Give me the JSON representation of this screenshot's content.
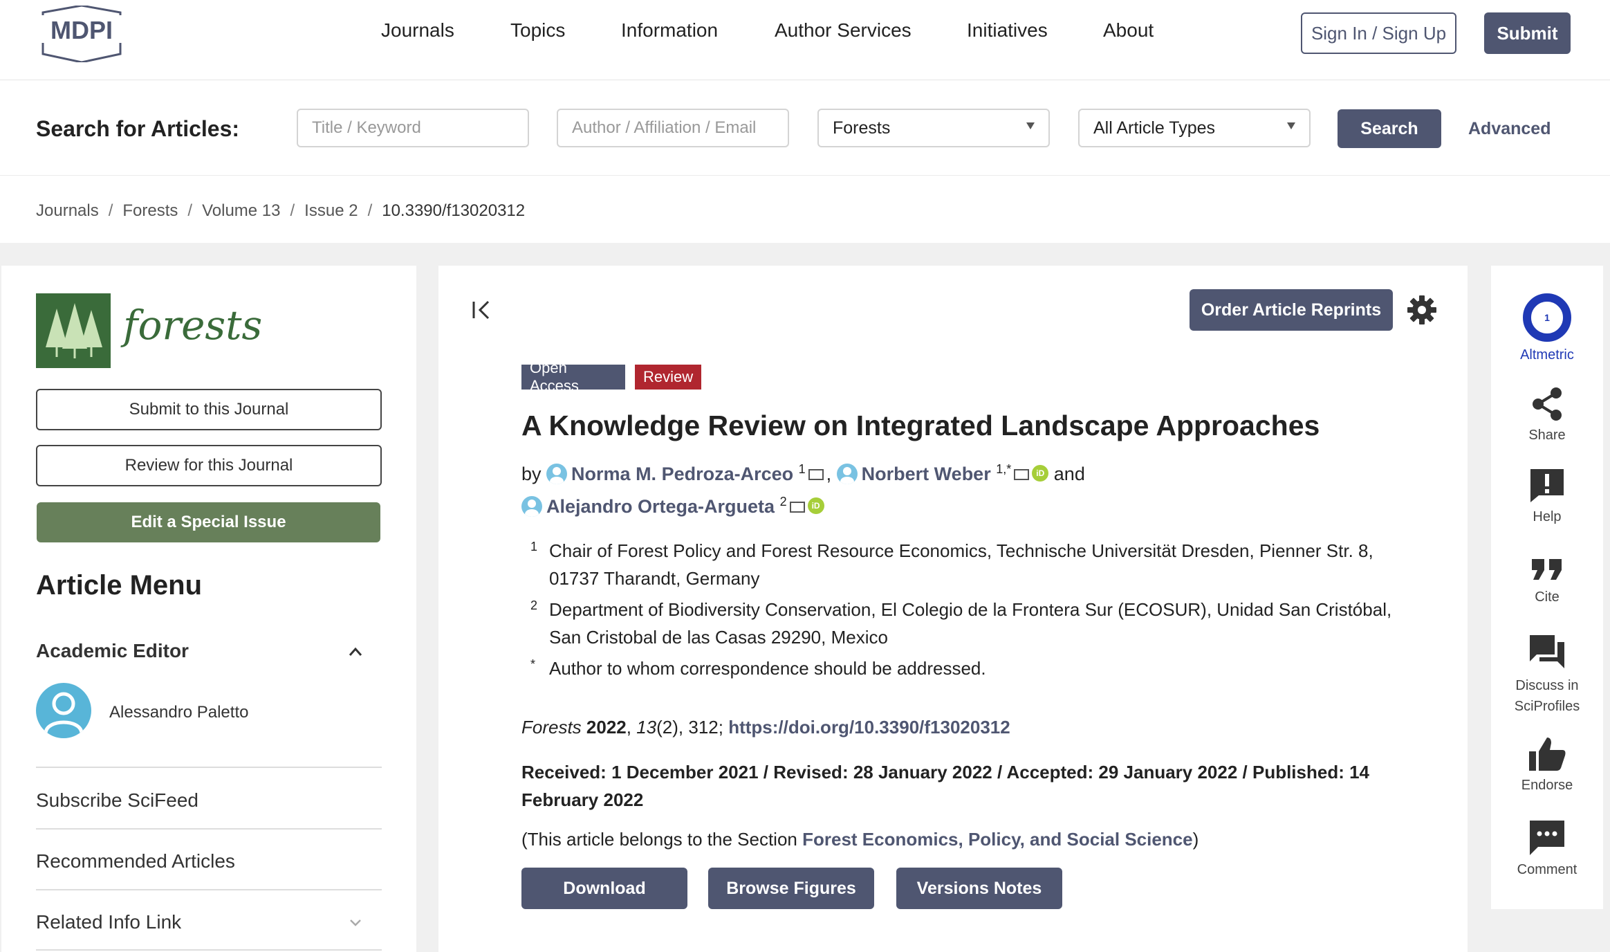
{
  "header": {
    "logo_text": "MDPI",
    "nav": [
      "Journals",
      "Topics",
      "Information",
      "Author Services",
      "Initiatives",
      "About"
    ],
    "signin_label": "Sign In / Sign Up",
    "submit_label": "Submit"
  },
  "search": {
    "label": "Search for Articles:",
    "title_placeholder": "Title / Keyword",
    "author_placeholder": "Author / Affiliation / Email",
    "journal_value": "Forests",
    "type_value": "All Article Types",
    "search_label": "Search",
    "advanced_label": "Advanced"
  },
  "breadcrumb": [
    "Journals",
    "Forests",
    "Volume 13",
    "Issue 2",
    "10.3390/f13020312"
  ],
  "sidebar": {
    "journal_name": "forests",
    "submit_label": "Submit to this Journal",
    "review_label": "Review for this Journal",
    "special_issue_label": "Edit a Special Issue",
    "menu_title": "Article Menu",
    "academic_editor_title": "Academic Editor",
    "editor_name": "Alessandro Paletto",
    "menu_items": [
      "Subscribe SciFeed",
      "Recommended Articles",
      "Related Info Link"
    ]
  },
  "article": {
    "reprints_label": "Order Article Reprints",
    "badge_open_access": "Open Access",
    "badge_type": "Review",
    "title": "A Knowledge Review on Integrated Landscape Approaches",
    "by": "by",
    "authors": [
      {
        "name": "Norma M. Pedroza-Arceo",
        "sup": "1"
      },
      {
        "name": "Norbert Weber",
        "sup": "1,*"
      },
      {
        "name": "Alejandro Ortega-Argueta",
        "sup": "2"
      }
    ],
    "and": "and",
    "orcid_text": "iD",
    "affiliations": [
      {
        "num": "1",
        "text": "Chair of Forest Policy and Forest Resource Economics, Technische Universität Dresden, Pienner Str. 8, 01737 Tharandt, Germany"
      },
      {
        "num": "2",
        "text": "Department of Biodiversity Conservation, El Colegio de la Frontera Sur (ECOSUR), Unidad San Cristóbal, San Cristobal de las Casas 29290, Mexico"
      },
      {
        "num": "*",
        "text": "Author to whom correspondence should be addressed."
      }
    ],
    "citation": {
      "journal": "Forests",
      "year": "2022",
      "volume": "13",
      "issue_pages": "(2), 312;",
      "doi": "https://doi.org/10.3390/f13020312"
    },
    "dates": "Received: 1 December 2021 / Revised: 28 January 2022 / Accepted: 29 January 2022 / Published: 14 February 2022",
    "section_prefix": "(This article belongs to the Section",
    "section_name": "Forest Economics, Policy, and Social Science",
    "section_suffix": ")",
    "buttons": [
      "Download",
      "Browse Figures",
      "Versions Notes"
    ]
  },
  "rail": {
    "altmetric_score": "1",
    "altmetric_label": "Altmetric",
    "share": "Share",
    "help": "Help",
    "cite": "Cite",
    "discuss": "Discuss in SciProfiles",
    "endorse": "Endorse",
    "comment": "Comment"
  },
  "colors": {
    "primary": "#4f5671",
    "review_badge": "#b0262f",
    "journal_green": "#3a6b3a",
    "special_issue_green": "#67805a",
    "altmetric_blue": "#1f39b5",
    "orcid_green": "#a6ce39"
  }
}
